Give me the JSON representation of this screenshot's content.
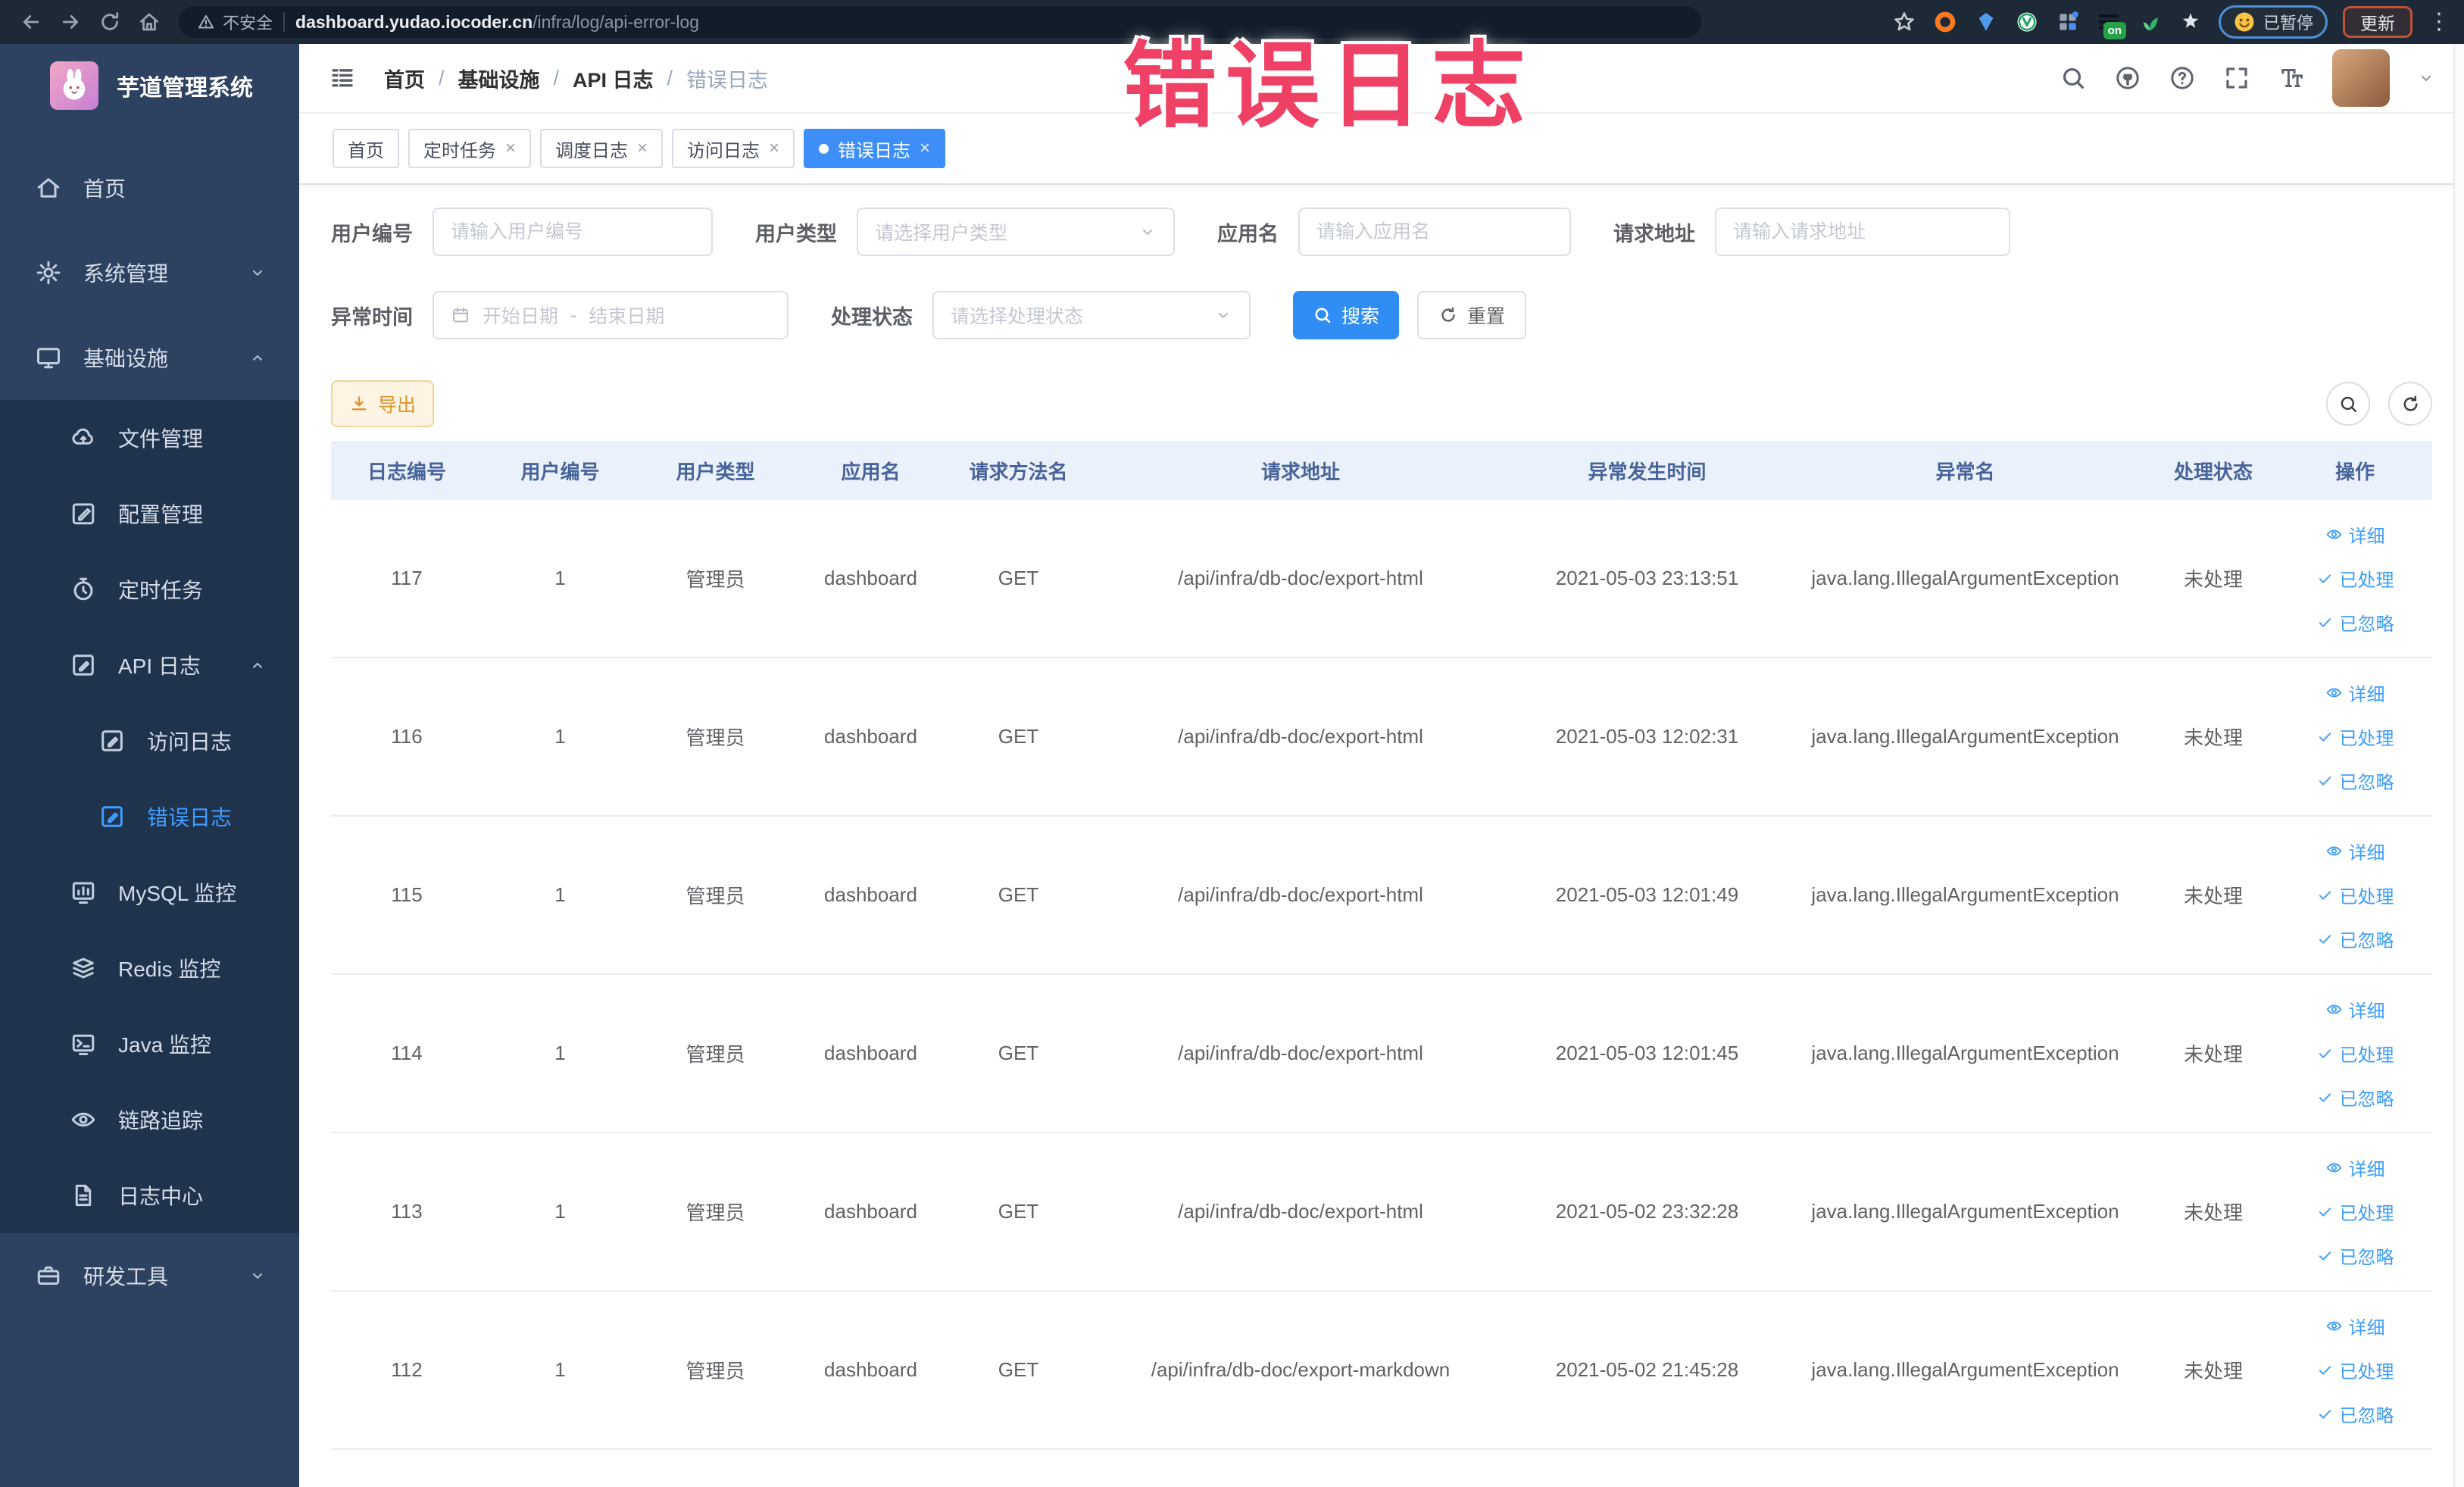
{
  "browser": {
    "security_label": "不安全",
    "url_domain": "dashboard.yudao.iocoder.cn",
    "url_path": "/infra/log/api-error-log",
    "on_badge": "on",
    "paused_label": "已暂停",
    "update_label": "更新"
  },
  "annotation": {
    "text": "错误日志"
  },
  "sidebar": {
    "title": "芋道管理系统",
    "items": [
      {
        "icon": "home-icon",
        "label": "首页",
        "level": 1,
        "group": false
      },
      {
        "icon": "gear-icon",
        "label": "系统管理",
        "level": 1,
        "group": false,
        "chevron": "down"
      },
      {
        "icon": "monitor-icon",
        "label": "基础设施",
        "level": 1,
        "group": false,
        "chevron": "up"
      },
      {
        "icon": "cloud-upload-icon",
        "label": "文件管理",
        "level": 2,
        "group": true
      },
      {
        "icon": "config-edit-icon",
        "label": "配置管理",
        "level": 2,
        "group": true
      },
      {
        "icon": "timer-icon",
        "label": "定时任务",
        "level": 2,
        "group": true
      },
      {
        "icon": "api-log-icon",
        "label": "API 日志",
        "level": 2,
        "group": true,
        "chevron": "up"
      },
      {
        "icon": "access-log-icon",
        "label": "访问日志",
        "level": 3,
        "group": true
      },
      {
        "icon": "error-log-icon",
        "label": "错误日志",
        "level": 3,
        "group": true,
        "active": true
      },
      {
        "icon": "mysql-monitor-icon",
        "label": "MySQL 监控",
        "level": 2,
        "group": true
      },
      {
        "icon": "redis-monitor-icon",
        "label": "Redis 监控",
        "level": 2,
        "group": true
      },
      {
        "icon": "java-monitor-icon",
        "label": "Java 监控",
        "level": 2,
        "group": true
      },
      {
        "icon": "trace-eye-icon",
        "label": "链路追踪",
        "level": 2,
        "group": true
      },
      {
        "icon": "log-center-icon",
        "label": "日志中心",
        "level": 2,
        "group": true
      },
      {
        "icon": "devtools-icon",
        "label": "研发工具",
        "level": 1,
        "group": false,
        "chevron": "down"
      }
    ]
  },
  "header": {
    "breadcrumb": [
      "首页",
      "基础设施",
      "API 日志",
      "错误日志"
    ]
  },
  "tabs": [
    {
      "label": "首页",
      "closable": false,
      "active": false
    },
    {
      "label": "定时任务",
      "closable": true,
      "active": false
    },
    {
      "label": "调度日志",
      "closable": true,
      "active": false
    },
    {
      "label": "访问日志",
      "closable": true,
      "active": false
    },
    {
      "label": "错误日志",
      "closable": true,
      "active": true
    }
  ],
  "filters": {
    "user_id": {
      "label": "用户编号",
      "placeholder": "请输入用户编号"
    },
    "user_type": {
      "label": "用户类型",
      "placeholder": "请选择用户类型"
    },
    "app_name": {
      "label": "应用名",
      "placeholder": "请输入应用名"
    },
    "request_url": {
      "label": "请求地址",
      "placeholder": "请输入请求地址"
    },
    "exception_time": {
      "label": "异常时间",
      "start_placeholder": "开始日期",
      "separator": "-",
      "end_placeholder": "结束日期"
    },
    "process_status": {
      "label": "处理状态",
      "placeholder": "请选择处理状态"
    },
    "search_label": "搜索",
    "reset_label": "重置"
  },
  "toolbar": {
    "export_label": "导出"
  },
  "table": {
    "columns": [
      "日志编号",
      "用户编号",
      "用户类型",
      "应用名",
      "请求方法名",
      "请求地址",
      "异常发生时间",
      "异常名",
      "处理状态",
      "操作"
    ],
    "rows": [
      [
        "117",
        "1",
        "管理员",
        "dashboard",
        "GET",
        "/api/infra/db-doc/export-html",
        "2021-05-03 23:13:51",
        "java.lang.IllegalArgumentException",
        "未处理"
      ],
      [
        "116",
        "1",
        "管理员",
        "dashboard",
        "GET",
        "/api/infra/db-doc/export-html",
        "2021-05-03 12:02:31",
        "java.lang.IllegalArgumentException",
        "未处理"
      ],
      [
        "115",
        "1",
        "管理员",
        "dashboard",
        "GET",
        "/api/infra/db-doc/export-html",
        "2021-05-03 12:01:49",
        "java.lang.IllegalArgumentException",
        "未处理"
      ],
      [
        "114",
        "1",
        "管理员",
        "dashboard",
        "GET",
        "/api/infra/db-doc/export-html",
        "2021-05-03 12:01:45",
        "java.lang.IllegalArgumentException",
        "未处理"
      ],
      [
        "113",
        "1",
        "管理员",
        "dashboard",
        "GET",
        "/api/infra/db-doc/export-html",
        "2021-05-02 23:32:28",
        "java.lang.IllegalArgumentException",
        "未处理"
      ],
      [
        "112",
        "1",
        "管理员",
        "dashboard",
        "GET",
        "/api/infra/db-doc/export-markdown",
        "2021-05-02 21:45:28",
        "java.lang.IllegalArgumentException",
        "未处理"
      ]
    ],
    "row_actions": [
      {
        "label": "详细",
        "icon": "eye"
      },
      {
        "label": "已处理",
        "icon": "check"
      },
      {
        "label": "已忽略",
        "icon": "check"
      }
    ]
  }
}
